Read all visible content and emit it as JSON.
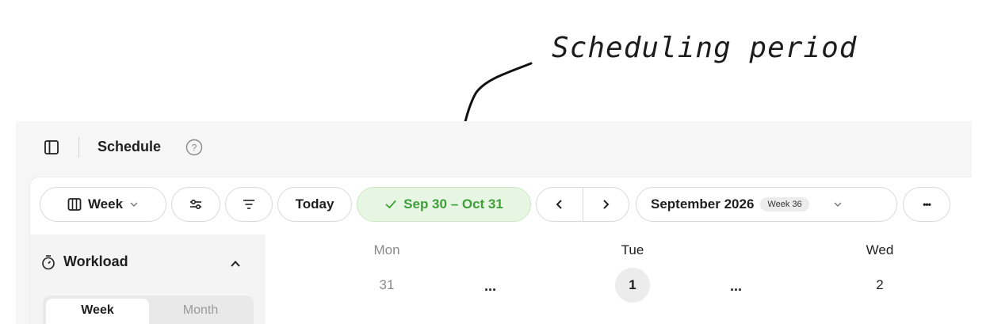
{
  "annotation": {
    "text": "Scheduling period"
  },
  "header": {
    "title": "Schedule"
  },
  "toolbar": {
    "view_label": "Week",
    "today_label": "Today",
    "period_label": "Sep 30 – Oct 31",
    "month_label": "September 2026",
    "week_badge": "Week 36",
    "more_label": "•••"
  },
  "sidebar": {
    "section_title": "Workload",
    "tabs": [
      {
        "label": "Week",
        "active": true
      },
      {
        "label": "Month",
        "active": false
      }
    ]
  },
  "calendar": {
    "days": [
      {
        "name": "Mon",
        "number": "31",
        "today": false,
        "muted": true
      },
      {
        "name": "Tue",
        "number": "1",
        "today": true,
        "muted": false
      },
      {
        "name": "Wed",
        "number": "2",
        "today": false,
        "muted": false
      }
    ],
    "more_label": "..."
  },
  "colors": {
    "accent_green": "#3c9f37",
    "period_bg": "#e7f6e3"
  },
  "icons": [
    "sidebar-toggle-icon",
    "help-icon",
    "columns-icon",
    "chevron-down-icon",
    "sliders-icon",
    "filter-icon",
    "check-icon",
    "chevron-left-icon",
    "chevron-right-icon",
    "more-icon",
    "stopwatch-icon",
    "chevron-up-icon"
  ]
}
